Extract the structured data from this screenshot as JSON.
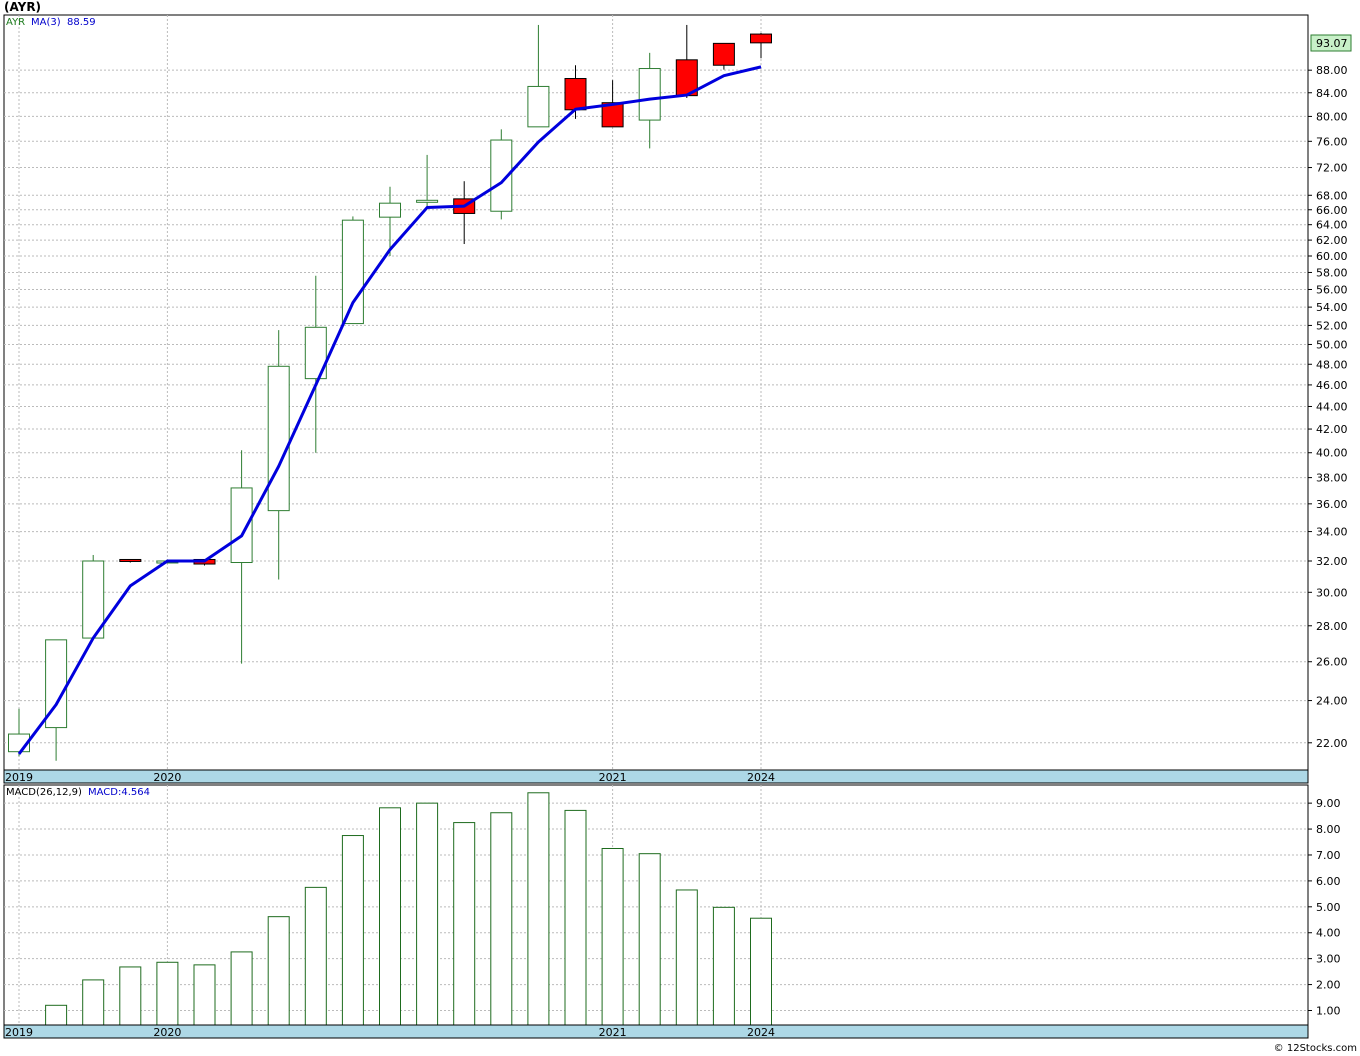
{
  "page": {
    "title": "(AYR)",
    "footer": "© 12Stocks.com"
  },
  "colors": {
    "up_candle": "#2e7d32",
    "down_candle": "#ff0000",
    "ma_line": "#0000dd",
    "macd_bar": "#1e6b1e",
    "axis_band": "#add8e6",
    "grid": "#bbbbbb",
    "last_price_bg": "#c8f0c8",
    "legend_symbol": "#1a7a1a",
    "legend_ma": "#0000cc"
  },
  "chart_data": [
    {
      "type": "candlestick",
      "legend": {
        "symbol": "AYR",
        "ma_label": "MA(3)",
        "ma_value": "88.59"
      },
      "last_price": "93.07",
      "y_scale": "log",
      "ylim": [
        20.8,
        98.6
      ],
      "y_ticks": [
        22,
        24,
        26,
        28,
        30,
        32,
        34,
        36,
        38,
        40,
        42,
        44,
        46,
        48,
        50,
        52,
        54,
        56,
        58,
        60,
        62,
        64,
        66,
        68,
        72,
        76,
        80,
        84,
        88
      ],
      "y_tick_labels": [
        "22.00",
        "24.00",
        "26.00",
        "28.00",
        "30.00",
        "32.00",
        "34.00",
        "36.00",
        "38.00",
        "40.00",
        "42.00",
        "44.00",
        "46.00",
        "48.00",
        "50.00",
        "52.00",
        "54.00",
        "56.00",
        "58.00",
        "60.00",
        "62.00",
        "64.00",
        "66.00",
        "68.00",
        "72.00",
        "76.00",
        "80.00",
        "84.00",
        "88.00"
      ],
      "x_labels": [
        {
          "label": "2019",
          "index": 0
        },
        {
          "label": "2020",
          "index": 4
        },
        {
          "label": "2021",
          "index": 16
        },
        {
          "label": "2024",
          "index": 20
        }
      ],
      "grid": true,
      "candles": [
        {
          "o": 21.6,
          "h": 23.6,
          "l": 21.4,
          "c": 22.4
        },
        {
          "o": 22.7,
          "h": 27.2,
          "l": 21.2,
          "c": 27.2
        },
        {
          "o": 27.3,
          "h": 32.4,
          "l": 27.3,
          "c": 32.0
        },
        {
          "o": 32.1,
          "h": 32.1,
          "l": 31.9,
          "c": 32.0
        },
        {
          "o": 32.0,
          "h": 32.1,
          "l": 31.9,
          "c": 32.0
        },
        {
          "o": 32.1,
          "h": 32.1,
          "l": 31.7,
          "c": 31.8
        },
        {
          "o": 31.9,
          "h": 40.2,
          "l": 25.9,
          "c": 37.2
        },
        {
          "o": 35.5,
          "h": 51.5,
          "l": 30.8,
          "c": 47.8
        },
        {
          "o": 46.6,
          "h": 57.6,
          "l": 40.0,
          "c": 51.8
        },
        {
          "o": 52.2,
          "h": 65.1,
          "l": 52.2,
          "c": 64.6
        },
        {
          "o": 65.0,
          "h": 69.2,
          "l": 60.0,
          "c": 66.9
        },
        {
          "o": 67.3,
          "h": 73.9,
          "l": 66.3,
          "c": 67.3
        },
        {
          "o": 67.5,
          "h": 70.0,
          "l": 61.5,
          "c": 65.5
        },
        {
          "o": 65.8,
          "h": 77.9,
          "l": 64.7,
          "c": 76.2
        },
        {
          "o": 78.3,
          "h": 96.6,
          "l": 78.3,
          "c": 85.1
        },
        {
          "o": 86.5,
          "h": 88.9,
          "l": 79.6,
          "c": 81.1
        },
        {
          "o": 82.3,
          "h": 86.2,
          "l": 78.3,
          "c": 78.3
        },
        {
          "o": 79.4,
          "h": 91.2,
          "l": 74.9,
          "c": 88.3
        },
        {
          "o": 89.9,
          "h": 96.6,
          "l": 83.1,
          "c": 83.5
        },
        {
          "o": 93.0,
          "h": 93.0,
          "l": 88.1,
          "c": 88.9
        },
        {
          "o": 94.8,
          "h": 95.0,
          "l": 90.2,
          "c": 93.1
        }
      ],
      "ma_series": {
        "name": "MA(3)",
        "values": [
          21.5,
          23.8,
          27.3,
          30.4,
          32.0,
          32.0,
          33.7,
          38.9,
          46.0,
          54.5,
          60.8,
          66.3,
          66.5,
          69.8,
          75.9,
          81.2,
          82.0,
          82.9,
          83.6,
          87.0,
          88.6
        ]
      }
    },
    {
      "type": "bar",
      "legend": {
        "label": "MACD(26,12,9)",
        "value_label": "MACD:4.564"
      },
      "ylim": [
        0.44,
        9.7
      ],
      "y_ticks": [
        1,
        2,
        3,
        4,
        5,
        6,
        7,
        8,
        9
      ],
      "y_tick_labels": [
        "1.00",
        "2.00",
        "3.00",
        "4.00",
        "5.00",
        "6.00",
        "7.00",
        "8.00",
        "9.00"
      ],
      "x_labels": [
        {
          "label": "2019",
          "index": 0
        },
        {
          "label": "2020",
          "index": 4
        },
        {
          "label": "2021",
          "index": 16
        },
        {
          "label": "2024",
          "index": 20
        }
      ],
      "grid": true,
      "values": [
        0.44,
        1.2,
        2.18,
        2.68,
        2.86,
        2.76,
        3.26,
        4.62,
        5.75,
        7.75,
        8.82,
        9.0,
        8.25,
        8.63,
        9.4,
        8.72,
        7.25,
        7.05,
        5.65,
        4.98,
        4.56
      ]
    }
  ]
}
